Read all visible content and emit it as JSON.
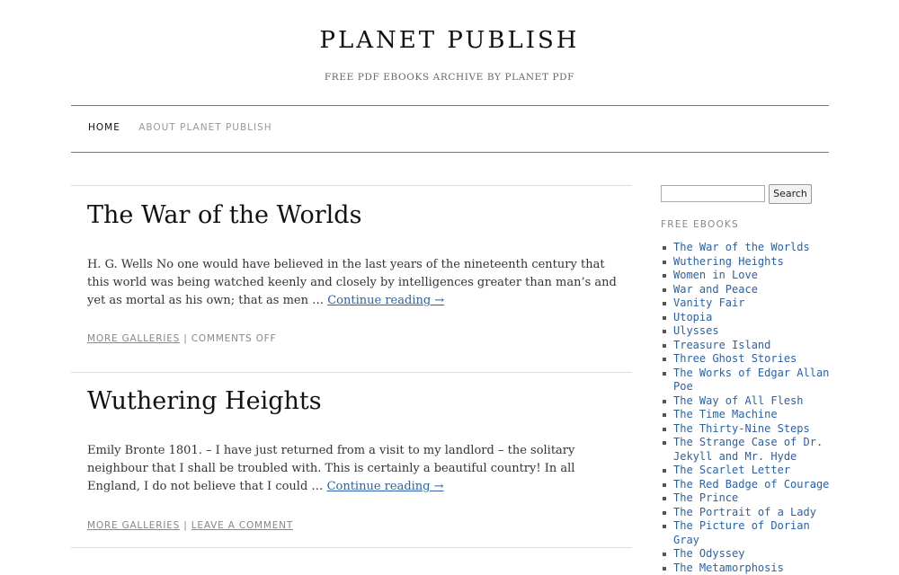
{
  "site": {
    "title": "PLANET PUBLISH",
    "description": "FREE PDF EBOOKS ARCHIVE BY PLANET PDF"
  },
  "nav": {
    "items": [
      {
        "label": "HOME",
        "active": true
      },
      {
        "label": "ABOUT PLANET PUBLISH",
        "active": false
      }
    ]
  },
  "posts": [
    {
      "title": "The War of the Worlds",
      "excerpt": "H. G. Wells No one would have believed in the last years of the nineteenth century that this world was being watched keenly and closely by intelligences greater than man’s and yet as mortal as his own; that as men …",
      "continue": "Continue reading →",
      "meta_category": "MORE GALLERIES",
      "meta_sep": " | ",
      "meta_comments": "COMMENTS OFF"
    },
    {
      "title": "Wuthering Heights",
      "excerpt": "Emily Bronte 1801. – I have just returned from a visit to my landlord – the solitary neighbour that I shall be troubled with. This is certainly a beautiful country! In all England, I do not believe that I could …",
      "continue": "Continue reading →",
      "meta_category": "MORE GALLERIES",
      "meta_sep": " | ",
      "meta_comments": "LEAVE A COMMENT"
    }
  ],
  "sidebar": {
    "search_button": "Search",
    "search_value": "",
    "widget_title": "FREE EBOOKS",
    "books": [
      "The War of the Worlds",
      "Wuthering Heights",
      "Women in Love",
      "War and Peace",
      "Vanity Fair",
      "Utopia",
      "Ulysses",
      "Treasure Island",
      "Three Ghost Stories",
      "The Works of Edgar Allan Poe",
      "The Way of All Flesh",
      "The Time Machine",
      "The Thirty-Nine Steps",
      "The Strange Case of Dr. Jekyll and Mr. Hyde",
      "The Scarlet Letter",
      "The Red Badge of Courage",
      "The Prince",
      "The Portrait of a Lady",
      "The Picture of Dorian Gray",
      "The Odyssey",
      "The Metamorphosis"
    ]
  },
  "colors": {
    "link": "#2a62a8",
    "text": "#333333",
    "muted": "#888888"
  }
}
